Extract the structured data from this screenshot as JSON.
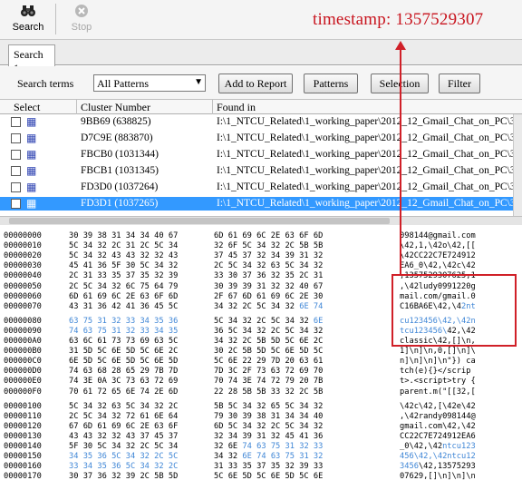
{
  "annotation": {
    "timestamp_label": "timestamp: 1357529307"
  },
  "toolbar": {
    "search_label": "Search",
    "stop_label": "Stop",
    "search_icon": "binoculars-icon",
    "stop_icon": "stop-icon"
  },
  "tabs": [
    {
      "label": "Search 1"
    }
  ],
  "controls": {
    "search_terms_label": "Search terms",
    "patterns_select_value": "All Patterns",
    "add_to_report_label": "Add to Report",
    "patterns_label": "Patterns",
    "selection_label": "Selection",
    "filter_label": "Filter"
  },
  "grid": {
    "columns": [
      "Select",
      "Cluster Number",
      "Found in"
    ],
    "rows": [
      {
        "cluster": "9BB69 (638825)",
        "found_in": "I:\\1_NTCU_Related\\1_working_paper\\2012_12_Gmail_Chat_on_PC\\3I",
        "selected": false
      },
      {
        "cluster": "D7C9E (883870)",
        "found_in": "I:\\1_NTCU_Related\\1_working_paper\\2012_12_Gmail_Chat_on_PC\\3I",
        "selected": false
      },
      {
        "cluster": "FBCB0 (1031344)",
        "found_in": "I:\\1_NTCU_Related\\1_working_paper\\2012_12_Gmail_Chat_on_PC\\3I",
        "selected": false
      },
      {
        "cluster": "FBCB1 (1031345)",
        "found_in": "I:\\1_NTCU_Related\\1_working_paper\\2012_12_Gmail_Chat_on_PC\\3I",
        "selected": false
      },
      {
        "cluster": "FD3D0 (1037264)",
        "found_in": "I:\\1_NTCU_Related\\1_working_paper\\2012_12_Gmail_Chat_on_PC\\3I",
        "selected": false
      },
      {
        "cluster": "FD3D1 (1037265)",
        "found_in": "I:\\1_NTCU_Related\\1_working_paper\\2012_12_Gmail_Chat_on_PC\\3I",
        "selected": true
      }
    ]
  },
  "hex_view": {
    "lines": [
      {
        "addr": "00000000",
        "h1": "30 39 38 31 34 34 40 67",
        "h2": "6D 61 69 6C 2E 63 6F 6D",
        "text": "098144@gmail.com"
      },
      {
        "addr": "00000010",
        "h1": "5C 34 32 2C 31 2C 5C 34",
        "h2": "32 6F 5C 34 32 2C 5B 5B",
        "text": "\\42,1,\\42o\\42,[["
      },
      {
        "addr": "00000020",
        "h1": "5C 34 32 43 43 32 32 43",
        "h2": "37 45 37 32 34 39 31 32",
        "text": "\\42CC22C7E724912"
      },
      {
        "addr": "00000030",
        "h1": "45 41 36 5F 30 5C 34 32",
        "h2": "2C 5C 34 32 63 5C 34 32",
        "text": "EA6_0\\42,\\42c\\42"
      },
      {
        "addr": "00000040",
        "h1": "2C 31 33 35 37 35 32 39",
        "h2": "33 30 37 36 32 35 2C 31",
        "text": ",1357529307625,1"
      },
      {
        "addr": "00000050",
        "h1": "2C 5C 34 32 6C 75 64 79",
        "h2": "30 39 39 31 32 32 40 67",
        "text": ",\\42ludy0991220g"
      },
      {
        "addr": "00000060",
        "h1": "6D 61 69 6C 2E 63 6F 6D",
        "h2": "2F 67 6D 61 69 6C 2E 30",
        "text": "mail.com/gmail.0"
      },
      {
        "addr": "00000070",
        "h1": "43 31 36 42 41 36 45 5C",
        "h2": "34 32 2C 5C 34 32 6E 74",
        "text": "C16BA6E\\42,\\42nt"
      },
      {
        "addr": "00000080",
        "h1": "63 75 31 32 33 34 35 36",
        "h2": "5C 34 32 2C 5C 34 32 6E",
        "text": "cu123456\\42,\\42n"
      },
      {
        "addr": "00000090",
        "h1": "74 63 75 31 32 33 34 35",
        "h2": "36 5C 34 32 2C 5C 34 32",
        "text": "tcu123456\\42,\\42"
      },
      {
        "addr": "000000A0",
        "h1": "63 6C 61 73 73 69 63 5C",
        "h2": "34 32 2C 5B 5D 5C 6E 2C",
        "text": "classic\\42,[]\\n,"
      },
      {
        "addr": "000000B0",
        "h1": "31 5D 5C 6E 5D 5C 6E 2C",
        "h2": "30 2C 5B 5D 5C 6E 5D 5C",
        "text": "1]\\n]\\n,0,[]\\n]\\"
      },
      {
        "addr": "000000C0",
        "h1": "6E 5D 5C 6E 5D 5C 6E 5D",
        "h2": "5C 6E 22 29 7D 20 63 61",
        "text": "n]\\n]\\n]\\n\"}) ca"
      },
      {
        "addr": "000000D0",
        "h1": "74 63 68 28 65 29 7B 7D",
        "h2": "7D 3C 2F 73 63 72 69 70",
        "text": "tch(e){}</scrip"
      },
      {
        "addr": "000000E0",
        "h1": "74 3E 0A 3C 73 63 72 69",
        "h2": "70 74 3E 74 72 79 20 7B",
        "text": "t>.<script>try {"
      },
      {
        "addr": "000000F0",
        "h1": "70 61 72 65 6E 74 2E 6D",
        "h2": "22 28 5B 5B 33 32 2C 5B",
        "text": "parent.m(\"[[32,["
      },
      {
        "addr": "00000100",
        "h1": "5C 34 32 63 5C 34 32 2C",
        "h2": "5B 5C 34 32 65 5C 34 32",
        "text": "\\42c\\42,[\\42e\\42"
      },
      {
        "addr": "00000110",
        "h1": "2C 5C 34 32 72 61 6E 64",
        "h2": "79 30 39 38 31 34 34 40",
        "text": ",\\42randy098144@"
      },
      {
        "addr": "00000120",
        "h1": "67 6D 61 69 6C 2E 63 6F",
        "h2": "6D 5C 34 32 2C 5C 34 32",
        "text": "gmail.com\\42,\\42"
      },
      {
        "addr": "00000130",
        "h1": "43 43 32 32 43 37 45 37",
        "h2": "32 34 39 31 32 45 41 36",
        "text": "CC22C7E724912EA6"
      },
      {
        "addr": "00000140",
        "h1": "5F 30 5C 34 32 2C 5C 34",
        "h2": "32 6E 74 63 75 31 32 33",
        "text": "_0\\42,\\42ntcu123"
      },
      {
        "addr": "00000150",
        "h1": "34 35 36 5C 34 32 2C 5C",
        "h2": "34 32 6E 74 63 75 31 32",
        "text": "456\\42,\\42ntcu12"
      },
      {
        "addr": "00000160",
        "h1": "33 34 35 36 5C 34 32 2C",
        "h2": "31 33 35 37 35 32 39 33",
        "text": "3456\\42,13575293"
      },
      {
        "addr": "00000170",
        "h1": "30 37 36 32 39 2C 5B 5D",
        "h2": "5C 6E 5D 5C 6E 5D 5C 6E",
        "text": "07629,[]\\n]\\n]\\n"
      }
    ]
  },
  "colors": {
    "annotation_red": "#d02028",
    "selection_blue": "#3399ff",
    "hex_highlight_blue": "#3f86d6"
  }
}
